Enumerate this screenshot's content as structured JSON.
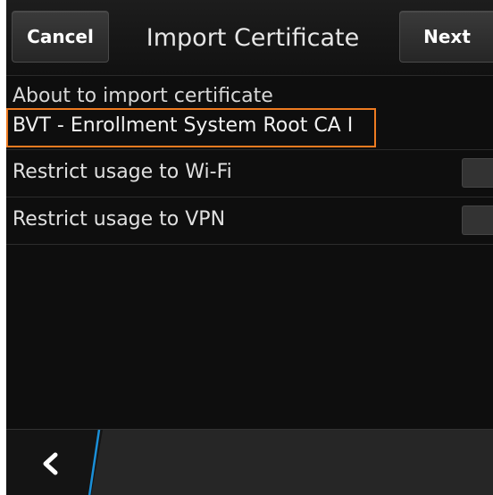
{
  "titlebar": {
    "cancel_label": "Cancel",
    "title": "Import Certificate",
    "next_label": "Next"
  },
  "content": {
    "about_text": "About to import certificate",
    "certificate_name": "BVT - Enrollment System Root CA I",
    "options": [
      {
        "label": "Restrict usage to Wi-Fi",
        "checked": false
      },
      {
        "label": "Restrict usage to VPN",
        "checked": false
      }
    ]
  },
  "actionbar": {
    "back_icon": "chevron-left-icon"
  },
  "colors": {
    "highlight": "#ee7b21",
    "accent_divider": "#1a8fd8",
    "background": "#0e0e0e"
  }
}
